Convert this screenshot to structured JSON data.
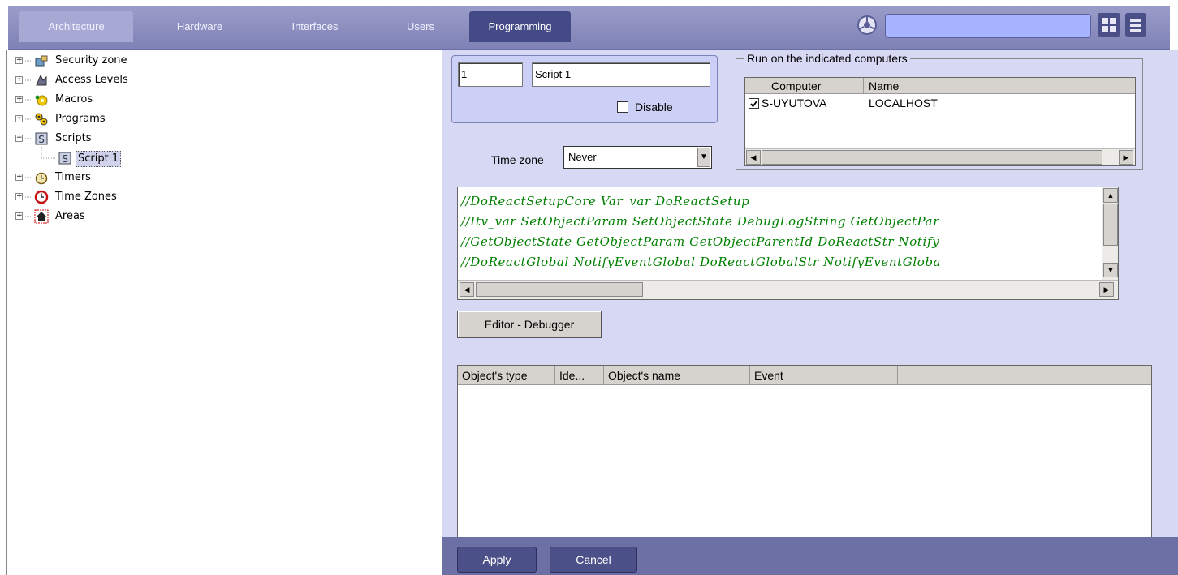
{
  "tabs": [
    {
      "label": "Architecture"
    },
    {
      "label": "Hardware"
    },
    {
      "label": "Interfaces"
    },
    {
      "label": "Users"
    },
    {
      "label": "Programming"
    }
  ],
  "tree": {
    "items": [
      {
        "label": "Security zone",
        "icon": "security-zone-icon"
      },
      {
        "label": "Access Levels",
        "icon": "access-levels-icon"
      },
      {
        "label": "Macros",
        "icon": "macros-icon"
      },
      {
        "label": "Programs",
        "icon": "programs-icon"
      },
      {
        "label": "Scripts",
        "icon": "scripts-icon"
      },
      {
        "label": "Script 1",
        "icon": "script-icon",
        "selected": true
      },
      {
        "label": "Timers",
        "icon": "timer-icon"
      },
      {
        "label": "Time Zones",
        "icon": "clock-icon"
      },
      {
        "label": "Areas",
        "icon": "house-icon"
      }
    ]
  },
  "form": {
    "id_value": "1",
    "name_value": "Script 1",
    "disable_label": "Disable",
    "disable_checked": false,
    "timezone_label": "Time zone",
    "timezone_value": "Never"
  },
  "computers": {
    "group_title": "Run on the indicated computers",
    "columns": [
      "Computer",
      "Name"
    ],
    "rows": [
      {
        "computer": "S-UYUTOVA",
        "name": "LOCALHOST",
        "checked": true
      }
    ]
  },
  "code": {
    "lines": [
      "//DoReactSetupCore Var_var DoReactSetup",
      "//Itv_var SetObjectParam SetObjectState DebugLogString GetObjectPar",
      "//GetObjectState GetObjectParam GetObjectParentId DoReactStr Notify",
      "//DoReactGlobal NotifyEventGlobal DoReactGlobalStr NotifyEventGloba"
    ]
  },
  "editor_button": "Editor - Debugger",
  "events_table": {
    "columns": [
      "Object's type",
      "Ide...",
      "Object's name",
      "Event"
    ]
  },
  "footer": {
    "apply": "Apply",
    "cancel": "Cancel"
  },
  "colors": {
    "tabbar": "#8c8fc2",
    "active_tab": "#444a85",
    "panel": "#d7d8f4",
    "code_text": "#008000",
    "footer": "#6d70a5"
  }
}
